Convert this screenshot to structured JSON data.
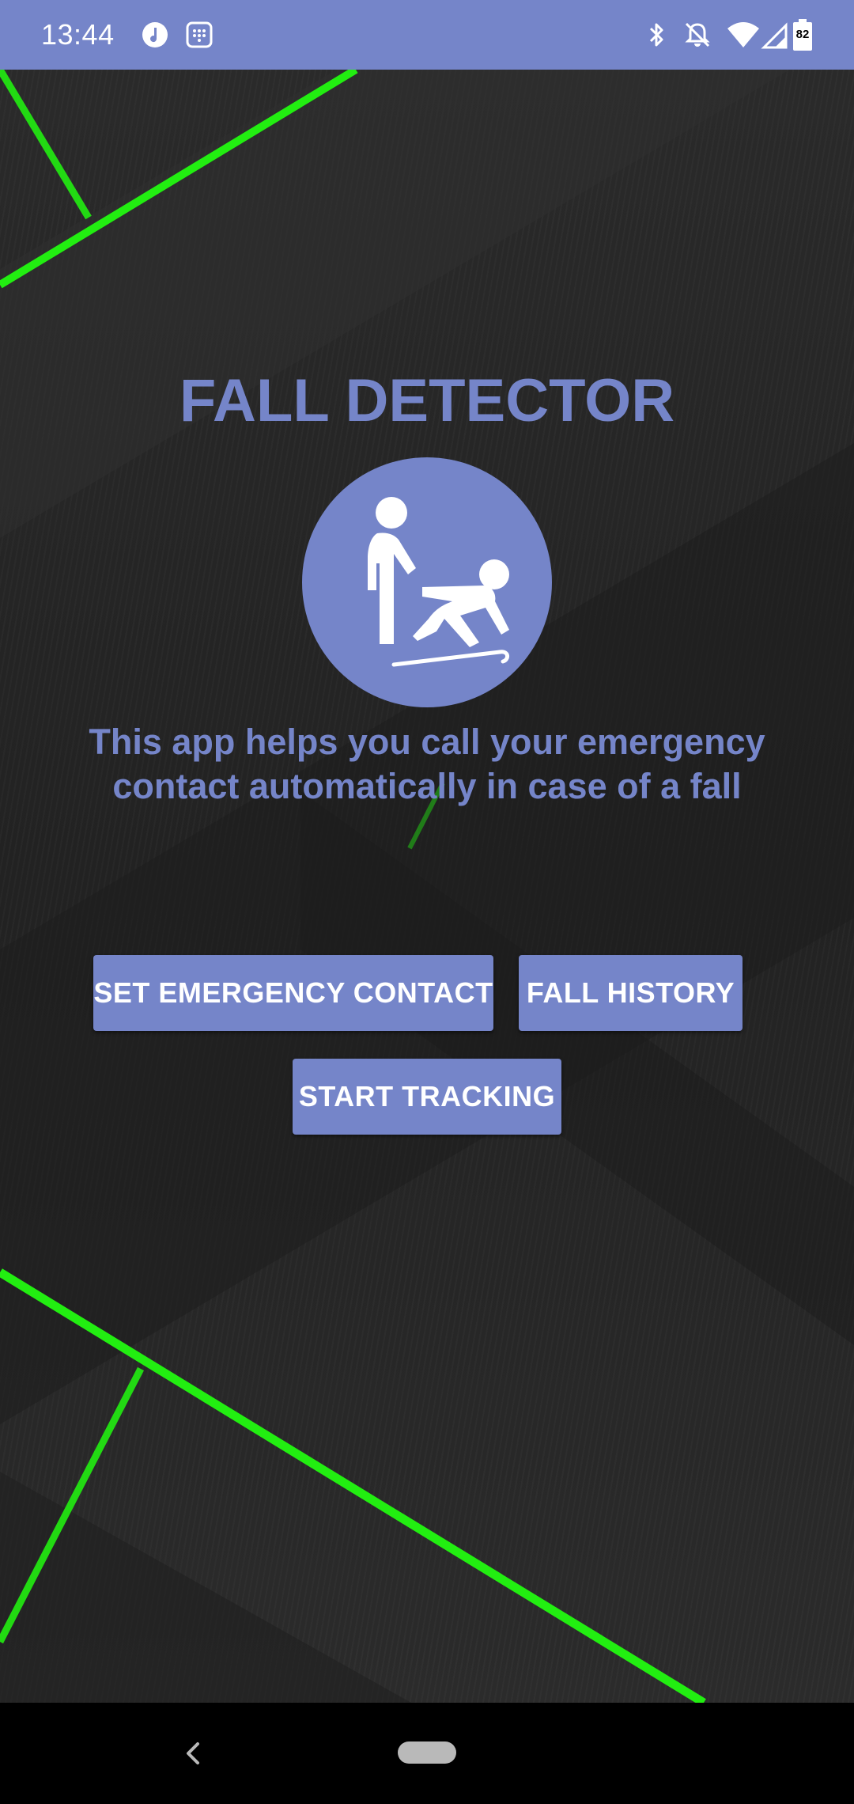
{
  "status_bar": {
    "time": "13:44",
    "battery_level": "82",
    "left_icons": [
      "music-notification-icon",
      "grid-notification-icon"
    ],
    "right_icons": [
      "bluetooth-icon",
      "notifications-off-icon",
      "wifi-icon",
      "cell-signal-icon",
      "battery-icon"
    ]
  },
  "app": {
    "title": "FALL DETECTOR",
    "logo_icon": "fall-assist-icon",
    "description": "This app helps you call your emergency contact automatically in case of a fall",
    "buttons": {
      "set_contact": "SET EMERGENCY CONTACT",
      "fall_history": "FALL HISTORY",
      "start_tracking": "START TRACKING"
    }
  },
  "navigation": {
    "back_icon": "back-chevron-icon",
    "home_icon": "home-pill-icon"
  },
  "colors": {
    "accent": "#7585c9",
    "neon_green": "#22ee11",
    "background_dark": "#242424",
    "nav_bar": "#000000"
  }
}
